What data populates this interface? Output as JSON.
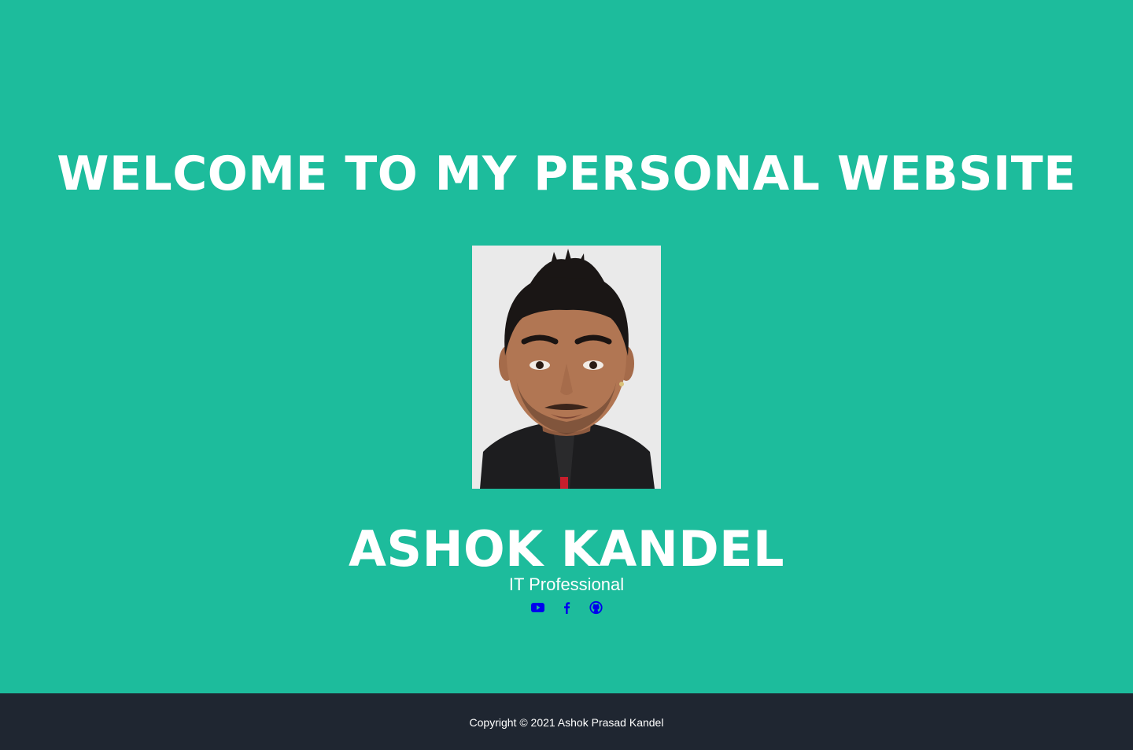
{
  "hero": {
    "title": "WELCOME TO MY PERSONAL WEBSITE",
    "background_color": "#1dbc9c"
  },
  "profile": {
    "photo_description_icon": "portrait-photo",
    "name": "ASHOK KANDEL",
    "role": "IT Professional"
  },
  "social": {
    "link_color": "#0000ee",
    "links": [
      {
        "icon": "youtube-icon"
      },
      {
        "icon": "facebook-icon"
      },
      {
        "icon": "github-icon"
      }
    ]
  },
  "footer": {
    "copyright": "Copyright © 2021 Ashok Prasad Kandel",
    "background_color": "#1f2631"
  }
}
